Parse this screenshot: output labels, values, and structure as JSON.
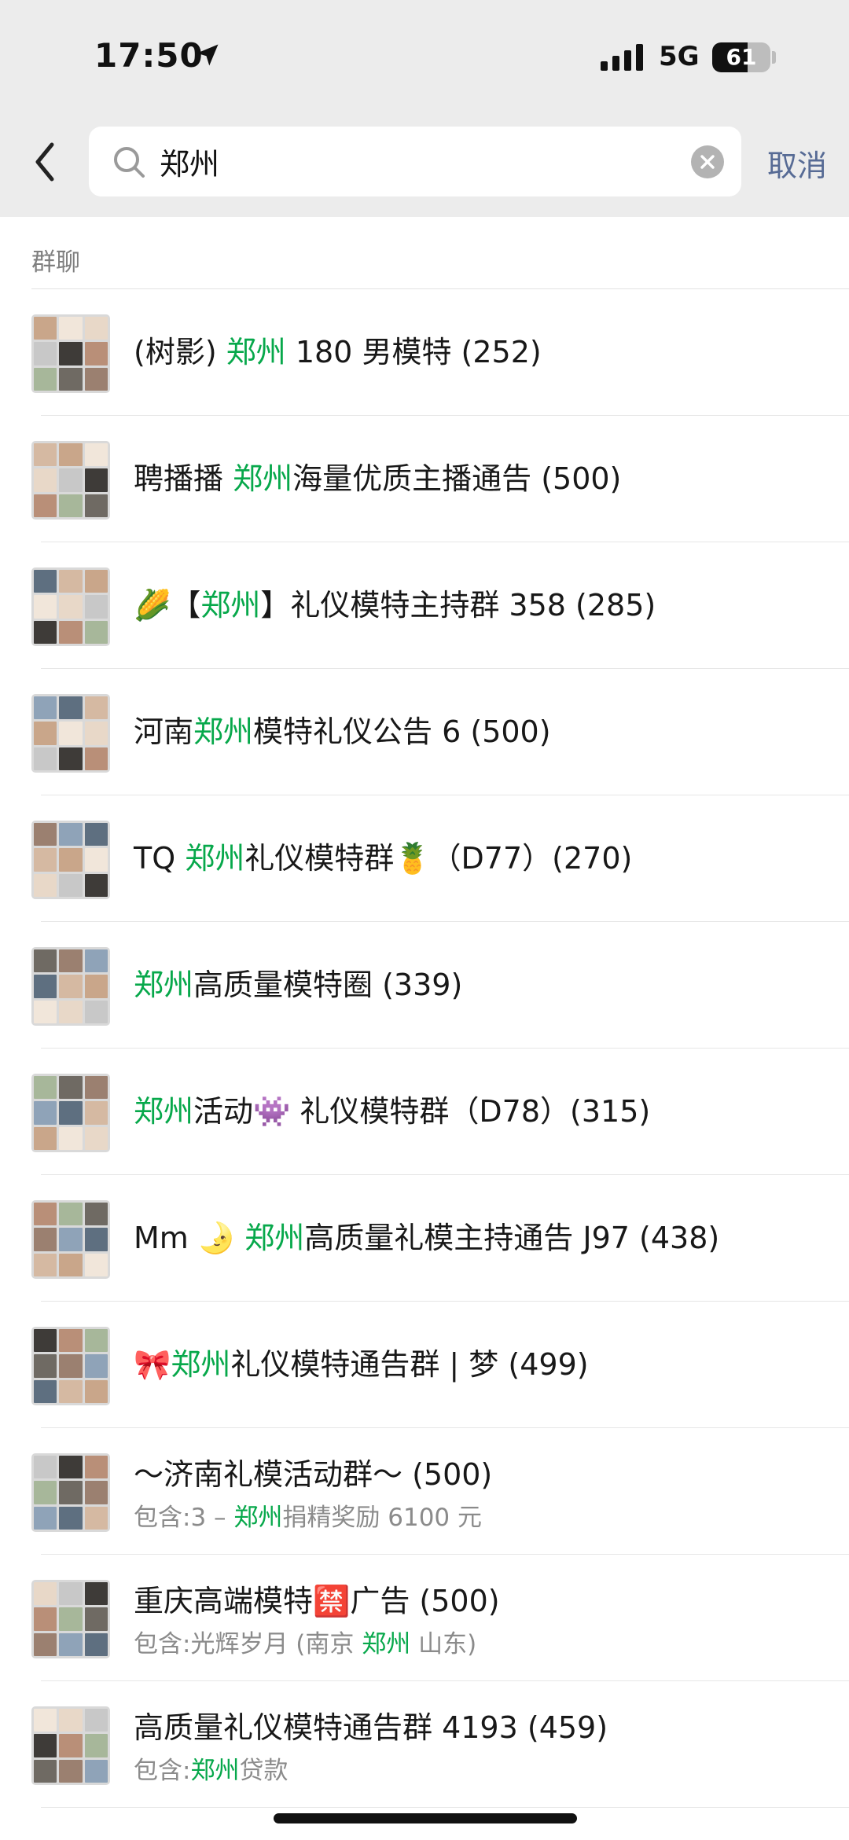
{
  "status_bar": {
    "time": "17:50",
    "network": "5G",
    "battery": "61",
    "battery_level": 0.61
  },
  "search": {
    "back_icon": "chevron-left-icon",
    "query": "郑州",
    "search_icon": "magnifier-icon",
    "clear_icon": "clear-circle-icon",
    "cancel_label": "取消"
  },
  "section": {
    "title": "群聊"
  },
  "colors": {
    "highlight": "#07a84b",
    "link": "#576b95",
    "header_bg": "#ececec",
    "secondary_text": "#8b8b8b"
  },
  "results": [
    {
      "title": {
        "pre": "(树影) ",
        "hl": "郑州",
        "post": " 180 男模特 (252)"
      }
    },
    {
      "title": {
        "pre": "聘播播 ",
        "hl": "郑州",
        "post": "海量优质主播通告 (500)"
      }
    },
    {
      "title": {
        "pre": "🌽【",
        "hl": "郑州",
        "post": "】礼仪模特主持群 358 (285)"
      }
    },
    {
      "title": {
        "pre": "河南",
        "hl": "郑州",
        "post": "模特礼仪公告 6 (500)"
      }
    },
    {
      "title": {
        "pre": "TQ ",
        "hl": "郑州",
        "post": "礼仪模特群🍍（D77）(270)"
      }
    },
    {
      "title": {
        "pre": "",
        "hl": "郑州",
        "post": "高质量模特圈 (339)"
      }
    },
    {
      "title": {
        "pre": "",
        "hl": "郑州",
        "post": "活动👾 礼仪模特群（D78）(315)"
      }
    },
    {
      "title": {
        "pre": "Mm 🌛 ",
        "hl": "郑州",
        "post": "高质量礼模主持通告 J97 (438)"
      }
    },
    {
      "title": {
        "pre": "🎀",
        "hl": "郑州",
        "post": "礼仪模特通告群 | 梦 (499)"
      }
    },
    {
      "title": {
        "pre": "～济南礼模活动群～ (500)",
        "hl": "",
        "post": ""
      },
      "sub": {
        "pre": "包含:3 – ",
        "hl": "郑州",
        "post": "捐精奖励 6100 元"
      }
    },
    {
      "title": {
        "pre": "重庆高端模特🈲广告 (500)",
        "hl": "",
        "post": ""
      },
      "sub": {
        "pre": "包含:光辉岁月 (南京 ",
        "hl": "郑州",
        "post": " 山东)"
      }
    },
    {
      "title": {
        "pre": "高质量礼仪模特通告群 4193 (459)",
        "hl": "",
        "post": ""
      },
      "sub": {
        "pre": "包含:",
        "hl": "郑州",
        "post": "贷款"
      }
    }
  ]
}
